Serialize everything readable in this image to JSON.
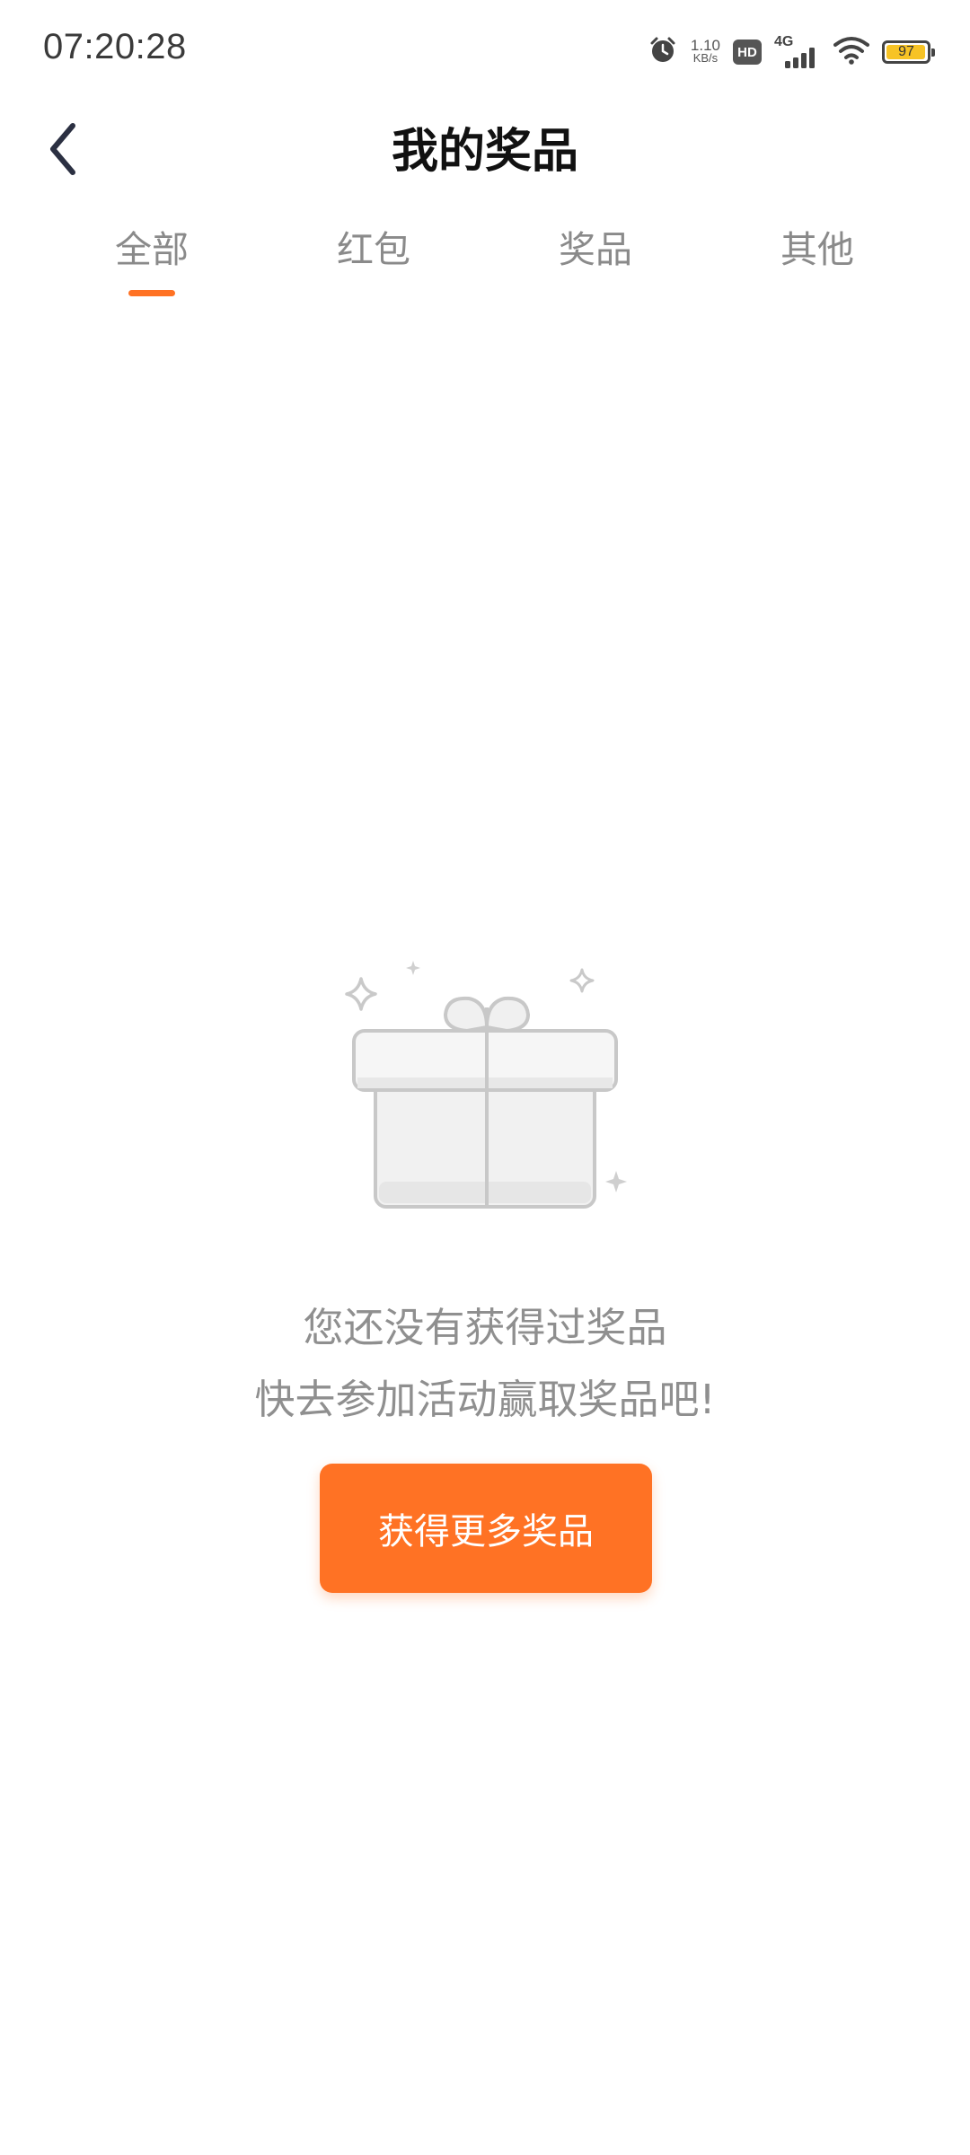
{
  "status_bar": {
    "time": "07:20:28",
    "net_speed_value": "1.10",
    "net_speed_unit": "KB/s",
    "hd_label": "HD",
    "network_type": "4G",
    "battery_level": "97",
    "battery_fraction": 0.97,
    "icons": [
      "alarm-icon",
      "hd-icon",
      "cellular-signal-icon",
      "wifi-icon",
      "battery-icon"
    ]
  },
  "header": {
    "title": "我的奖品",
    "back_icon": "chevron-left-icon"
  },
  "tabs": [
    {
      "label": "全部",
      "active": true
    },
    {
      "label": "红包",
      "active": false
    },
    {
      "label": "奖品",
      "active": false
    },
    {
      "label": "其他",
      "active": false
    }
  ],
  "empty_state": {
    "icon": "gift-box-icon",
    "line1": "您还没有获得过奖品",
    "line2": "快去参加活动赢取奖品吧!",
    "button_label": "获得更多奖品"
  },
  "colors": {
    "accent": "#ff7224",
    "text_primary": "#111111",
    "text_secondary": "#8f8f8f",
    "battery_fill": "#f7c325"
  }
}
